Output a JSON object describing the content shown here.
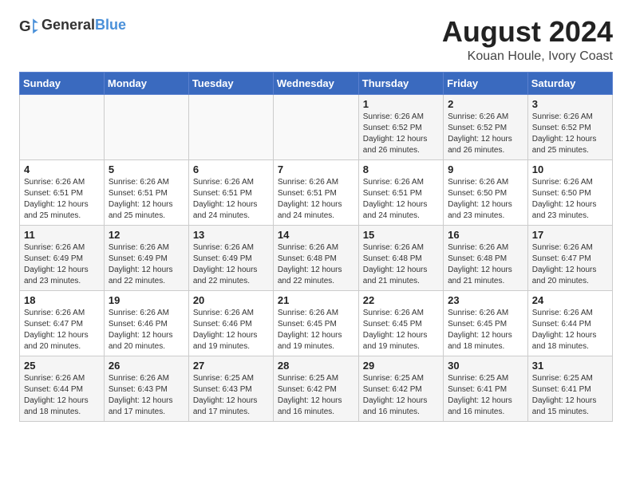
{
  "header": {
    "logo_general": "General",
    "logo_blue": "Blue",
    "month_year": "August 2024",
    "location": "Kouan Houle, Ivory Coast"
  },
  "calendar": {
    "days_of_week": [
      "Sunday",
      "Monday",
      "Tuesday",
      "Wednesday",
      "Thursday",
      "Friday",
      "Saturday"
    ],
    "weeks": [
      [
        {
          "day": "",
          "info": ""
        },
        {
          "day": "",
          "info": ""
        },
        {
          "day": "",
          "info": ""
        },
        {
          "day": "",
          "info": ""
        },
        {
          "day": "1",
          "info": "Sunrise: 6:26 AM\nSunset: 6:52 PM\nDaylight: 12 hours\nand 26 minutes."
        },
        {
          "day": "2",
          "info": "Sunrise: 6:26 AM\nSunset: 6:52 PM\nDaylight: 12 hours\nand 26 minutes."
        },
        {
          "day": "3",
          "info": "Sunrise: 6:26 AM\nSunset: 6:52 PM\nDaylight: 12 hours\nand 25 minutes."
        }
      ],
      [
        {
          "day": "4",
          "info": "Sunrise: 6:26 AM\nSunset: 6:51 PM\nDaylight: 12 hours\nand 25 minutes."
        },
        {
          "day": "5",
          "info": "Sunrise: 6:26 AM\nSunset: 6:51 PM\nDaylight: 12 hours\nand 25 minutes."
        },
        {
          "day": "6",
          "info": "Sunrise: 6:26 AM\nSunset: 6:51 PM\nDaylight: 12 hours\nand 24 minutes."
        },
        {
          "day": "7",
          "info": "Sunrise: 6:26 AM\nSunset: 6:51 PM\nDaylight: 12 hours\nand 24 minutes."
        },
        {
          "day": "8",
          "info": "Sunrise: 6:26 AM\nSunset: 6:51 PM\nDaylight: 12 hours\nand 24 minutes."
        },
        {
          "day": "9",
          "info": "Sunrise: 6:26 AM\nSunset: 6:50 PM\nDaylight: 12 hours\nand 23 minutes."
        },
        {
          "day": "10",
          "info": "Sunrise: 6:26 AM\nSunset: 6:50 PM\nDaylight: 12 hours\nand 23 minutes."
        }
      ],
      [
        {
          "day": "11",
          "info": "Sunrise: 6:26 AM\nSunset: 6:49 PM\nDaylight: 12 hours\nand 23 minutes."
        },
        {
          "day": "12",
          "info": "Sunrise: 6:26 AM\nSunset: 6:49 PM\nDaylight: 12 hours\nand 22 minutes."
        },
        {
          "day": "13",
          "info": "Sunrise: 6:26 AM\nSunset: 6:49 PM\nDaylight: 12 hours\nand 22 minutes."
        },
        {
          "day": "14",
          "info": "Sunrise: 6:26 AM\nSunset: 6:48 PM\nDaylight: 12 hours\nand 22 minutes."
        },
        {
          "day": "15",
          "info": "Sunrise: 6:26 AM\nSunset: 6:48 PM\nDaylight: 12 hours\nand 21 minutes."
        },
        {
          "day": "16",
          "info": "Sunrise: 6:26 AM\nSunset: 6:48 PM\nDaylight: 12 hours\nand 21 minutes."
        },
        {
          "day": "17",
          "info": "Sunrise: 6:26 AM\nSunset: 6:47 PM\nDaylight: 12 hours\nand 20 minutes."
        }
      ],
      [
        {
          "day": "18",
          "info": "Sunrise: 6:26 AM\nSunset: 6:47 PM\nDaylight: 12 hours\nand 20 minutes."
        },
        {
          "day": "19",
          "info": "Sunrise: 6:26 AM\nSunset: 6:46 PM\nDaylight: 12 hours\nand 20 minutes."
        },
        {
          "day": "20",
          "info": "Sunrise: 6:26 AM\nSunset: 6:46 PM\nDaylight: 12 hours\nand 19 minutes."
        },
        {
          "day": "21",
          "info": "Sunrise: 6:26 AM\nSunset: 6:45 PM\nDaylight: 12 hours\nand 19 minutes."
        },
        {
          "day": "22",
          "info": "Sunrise: 6:26 AM\nSunset: 6:45 PM\nDaylight: 12 hours\nand 19 minutes."
        },
        {
          "day": "23",
          "info": "Sunrise: 6:26 AM\nSunset: 6:45 PM\nDaylight: 12 hours\nand 18 minutes."
        },
        {
          "day": "24",
          "info": "Sunrise: 6:26 AM\nSunset: 6:44 PM\nDaylight: 12 hours\nand 18 minutes."
        }
      ],
      [
        {
          "day": "25",
          "info": "Sunrise: 6:26 AM\nSunset: 6:44 PM\nDaylight: 12 hours\nand 18 minutes."
        },
        {
          "day": "26",
          "info": "Sunrise: 6:26 AM\nSunset: 6:43 PM\nDaylight: 12 hours\nand 17 minutes."
        },
        {
          "day": "27",
          "info": "Sunrise: 6:25 AM\nSunset: 6:43 PM\nDaylight: 12 hours\nand 17 minutes."
        },
        {
          "day": "28",
          "info": "Sunrise: 6:25 AM\nSunset: 6:42 PM\nDaylight: 12 hours\nand 16 minutes."
        },
        {
          "day": "29",
          "info": "Sunrise: 6:25 AM\nSunset: 6:42 PM\nDaylight: 12 hours\nand 16 minutes."
        },
        {
          "day": "30",
          "info": "Sunrise: 6:25 AM\nSunset: 6:41 PM\nDaylight: 12 hours\nand 16 minutes."
        },
        {
          "day": "31",
          "info": "Sunrise: 6:25 AM\nSunset: 6:41 PM\nDaylight: 12 hours\nand 15 minutes."
        }
      ]
    ]
  }
}
